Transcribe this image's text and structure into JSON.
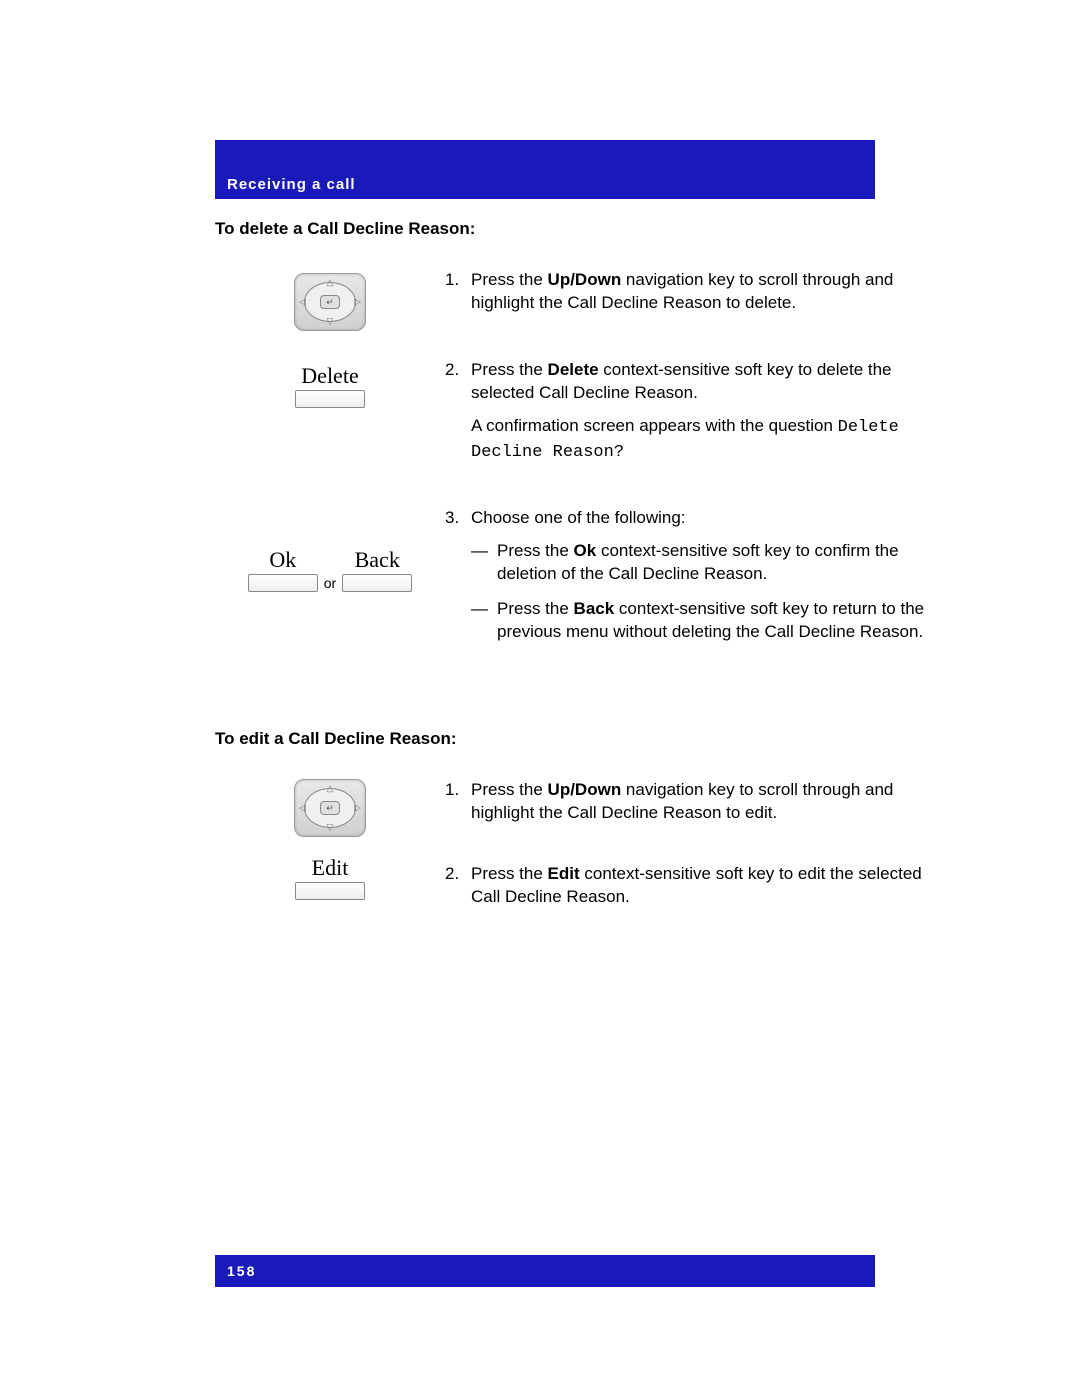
{
  "header": {
    "title": "Receiving a call"
  },
  "section1": {
    "title": "To delete a Call Decline Reason:",
    "softkeys": {
      "delete": "Delete",
      "ok": "Ok",
      "back": "Back",
      "or": "or"
    },
    "steps": {
      "s1_num": "1.",
      "s1_prefix": "Press the ",
      "s1_bold": "Up/Down",
      "s1_suffix": " navigation key to scroll through and highlight the Call Decline Reason to delete.",
      "s2_num": "2.",
      "s2_prefix": "Press the ",
      "s2_bold": "Delete",
      "s2_suffix": " context-sensitive soft key to delete the selected Call Decline Reason.",
      "s2_para_prefix": "A confirmation screen appears with the question ",
      "s2_para_mono": "Delete Decline Reason?",
      "s3_num": "3.",
      "s3_text": "Choose one of the following:",
      "sub1_dash": "—",
      "sub1_prefix": "Press the ",
      "sub1_bold": "Ok",
      "sub1_suffix": " context-sensitive soft key to confirm the deletion of the Call Decline Reason.",
      "sub2_dash": "—",
      "sub2_prefix": "Press the ",
      "sub2_bold": "Back",
      "sub2_suffix": " context-sensitive soft key to return to the previous menu without deleting the Call Decline Reason."
    }
  },
  "section2": {
    "title": "To edit a Call Decline Reason:",
    "softkeys": {
      "edit": "Edit"
    },
    "steps": {
      "s1_num": "1.",
      "s1_prefix": "Press the ",
      "s1_bold": "Up/Down",
      "s1_suffix": " navigation key to scroll through and highlight the Call Decline Reason to edit.",
      "s2_num": "2.",
      "s2_prefix": "Press the ",
      "s2_bold": "Edit",
      "s2_suffix": " context-sensitive soft key to edit the selected Call Decline Reason."
    }
  },
  "footer": {
    "page": "158"
  }
}
